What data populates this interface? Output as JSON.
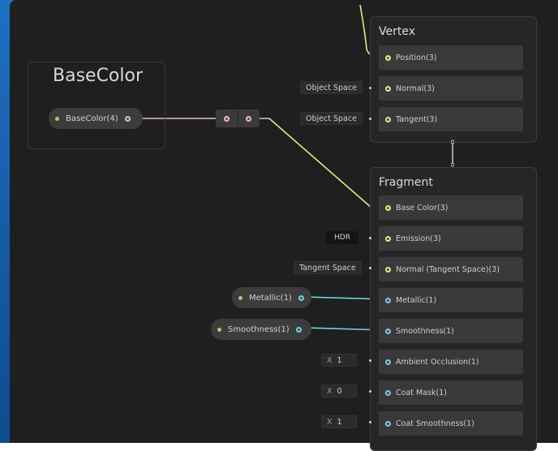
{
  "groups": {
    "basecolor_group": {
      "title": "BaseColor"
    }
  },
  "properties": {
    "basecolor": {
      "label": "BaseColor(4)",
      "port_color": "#e7b6dd"
    },
    "metallic": {
      "label": "Metallic(1)",
      "port_color": "#72d2e4"
    },
    "smoothness": {
      "label": "Smoothness(1)",
      "port_color": "#72d2e4"
    }
  },
  "vertex": {
    "title": "Vertex",
    "slots": [
      {
        "label": "Position(3)",
        "inline": ""
      },
      {
        "label": "Normal(3)",
        "inline": "Object Space"
      },
      {
        "label": "Tangent(3)",
        "inline": "Object Space"
      }
    ]
  },
  "fragment": {
    "title": "Fragment",
    "slots": [
      {
        "label": "Base Color(3)",
        "inline": ""
      },
      {
        "label": "Emission(3)",
        "inline": "HDR"
      },
      {
        "label": "Normal (Tangent Space)(3)",
        "inline": "Tangent Space"
      },
      {
        "label": "Metallic(1)",
        "inline": ""
      },
      {
        "label": "Smoothness(1)",
        "inline": ""
      },
      {
        "label": "Ambient Occlusion(1)",
        "inline_label": "X",
        "inline": "1"
      },
      {
        "label": "Coat Mask(1)",
        "inline_label": "X",
        "inline": "0"
      },
      {
        "label": "Coat Smoothness(1)",
        "inline_label": "X",
        "inline": "1"
      }
    ]
  },
  "colors": {
    "canvas": "#1f1f1f",
    "wire_pink": "#e7b6dd",
    "wire_cyan": "#72d2e4",
    "wire_yellow": "#e8e77f",
    "wire_white": "#d8d8d8"
  }
}
